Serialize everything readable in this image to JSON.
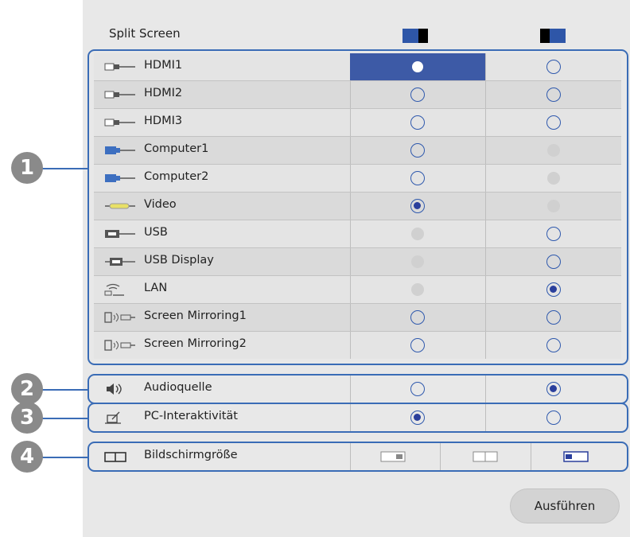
{
  "panel": {
    "title": "Split Screen"
  },
  "source_rows": [
    {
      "label": "HDMI1",
      "icon": "hdmi-icon",
      "left": "selected",
      "right": "empty"
    },
    {
      "label": "HDMI2",
      "icon": "hdmi-icon",
      "left": "empty",
      "right": "empty"
    },
    {
      "label": "HDMI3",
      "icon": "hdmi-icon",
      "left": "empty",
      "right": "empty"
    },
    {
      "label": "Computer1",
      "icon": "computer-icon",
      "left": "empty",
      "right": "disabled"
    },
    {
      "label": "Computer2",
      "icon": "computer-icon",
      "left": "empty",
      "right": "disabled"
    },
    {
      "label": "Video",
      "icon": "video-icon",
      "left": "checked",
      "right": "disabled"
    },
    {
      "label": "USB",
      "icon": "usb-icon",
      "left": "disabled",
      "right": "empty"
    },
    {
      "label": "USB Display",
      "icon": "usb-display-icon",
      "left": "disabled",
      "right": "empty"
    },
    {
      "label": "LAN",
      "icon": "lan-icon",
      "left": "disabled",
      "right": "checked"
    },
    {
      "label": "Screen Mirroring1",
      "icon": "screen-mirroring-icon",
      "left": "empty",
      "right": "empty"
    },
    {
      "label": "Screen Mirroring2",
      "icon": "screen-mirroring-icon",
      "left": "empty",
      "right": "empty"
    }
  ],
  "audio": {
    "label": "Audioquelle",
    "icon": "speaker-icon",
    "left": "empty",
    "right": "checked"
  },
  "pc": {
    "label": "PC-Interaktivität",
    "icon": "pen-tablet-icon",
    "left": "checked",
    "right": "empty"
  },
  "screen_size": {
    "label": "Bildschirmgröße",
    "icon": "screen-size-icon",
    "options": [
      "left-large",
      "equal",
      "right-large"
    ],
    "selected": "right-large"
  },
  "callouts": [
    "1",
    "2",
    "3",
    "4"
  ],
  "execute_label": "Ausführen",
  "colors": {
    "accent": "#3d5aa6",
    "group_border": "#3a6cb6",
    "radio_border": "#2f59ad",
    "header_blue": "#2e56a8"
  }
}
